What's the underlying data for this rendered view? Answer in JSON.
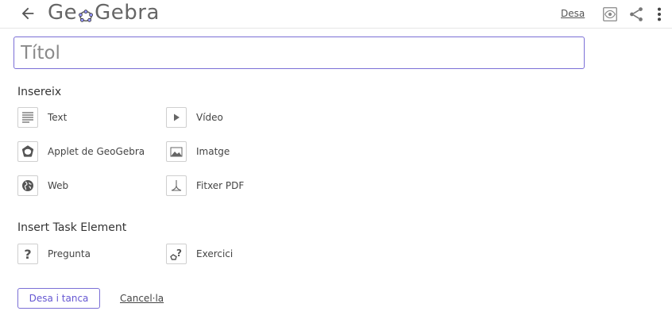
{
  "header": {
    "logo_text_left": "Ge",
    "logo_text_right": "Gebra",
    "save_label": "Desa",
    "back_icon": "arrow-left-icon",
    "view_icon": "eye-view-icon",
    "share_icon": "share-icon",
    "menu_icon": "more-vertical-icon"
  },
  "title_input": {
    "placeholder": "Títol",
    "value": ""
  },
  "insert_section": {
    "title": "Insereix",
    "items": [
      {
        "label": "Text",
        "icon": "text-lines-icon"
      },
      {
        "label": "Vídeo",
        "icon": "video-play-icon"
      },
      {
        "label": "Applet de GeoGebra",
        "icon": "geogebra-applet-icon"
      },
      {
        "label": "Imatge",
        "icon": "image-icon"
      },
      {
        "label": "Web",
        "icon": "globe-icon"
      },
      {
        "label": "Fitxer PDF",
        "icon": "pdf-icon"
      }
    ]
  },
  "task_section": {
    "title": "Insert Task Element",
    "items": [
      {
        "label": "Pregunta",
        "icon": "question-icon"
      },
      {
        "label": "Exercici",
        "icon": "exercise-icon"
      }
    ]
  },
  "footer": {
    "save_close_label": "Desa i tanca",
    "cancel_label": "Cancel·la"
  },
  "colors": {
    "accent": "#6557d2",
    "input_border": "#7b6fd6",
    "icon_gray": "#777777"
  }
}
